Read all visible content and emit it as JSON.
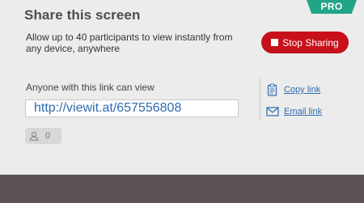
{
  "header": {
    "title": "Share this screen",
    "badge": "PRO"
  },
  "description": "Allow up to 40 participants to view instantly from any device, anywhere",
  "stop_button": {
    "label": "Stop Sharing"
  },
  "link_section": {
    "label": "Anyone with this link can view",
    "url": "http://viewit.at/657556808"
  },
  "participants": {
    "count": "0",
    "icon": "person-icon"
  },
  "actions": {
    "copy_label": "Copy link",
    "copy_icon": "clipboard-icon",
    "email_label": "Email link",
    "email_icon": "envelope-icon"
  },
  "colors": {
    "accent_red": "#c8101b",
    "pro_green": "#22a488",
    "link_blue": "#2f6cb0",
    "footer": "#5d5257"
  }
}
